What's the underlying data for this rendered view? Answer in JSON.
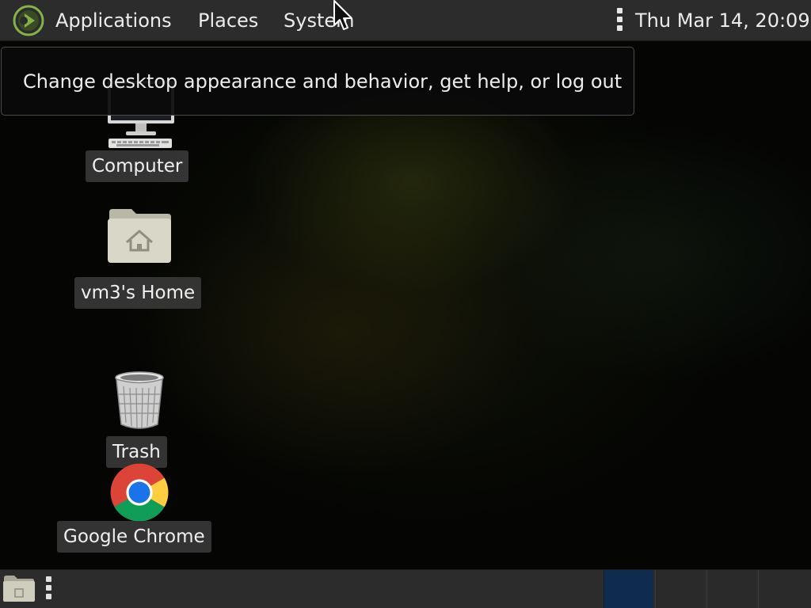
{
  "top_panel": {
    "menus": [
      {
        "label": "Applications"
      },
      {
        "label": "Places"
      },
      {
        "label": "System"
      }
    ],
    "clock": "Thu Mar 14, 20:09",
    "logo_icon": "mate-menu-logo-icon"
  },
  "tooltip": {
    "text": "Change desktop appearance and behavior, get help, or log out"
  },
  "desktop": {
    "icons": [
      {
        "label": "Computer",
        "icon": "computer-icon"
      },
      {
        "label": "vm3's Home",
        "icon": "home-folder-icon"
      },
      {
        "label": "Trash",
        "icon": "trash-icon"
      },
      {
        "label": "Google Chrome",
        "icon": "chrome-icon"
      }
    ]
  },
  "bottom_panel": {
    "show_desktop_icon": "show-desktop-icon",
    "workspaces": [
      {
        "active": true
      },
      {
        "active": false
      },
      {
        "active": false
      },
      {
        "active": false
      }
    ]
  },
  "colors": {
    "panel_bg": "#2c2c2c",
    "active_workspace": "#0f2b4e",
    "logo_green": "#86b04a"
  }
}
